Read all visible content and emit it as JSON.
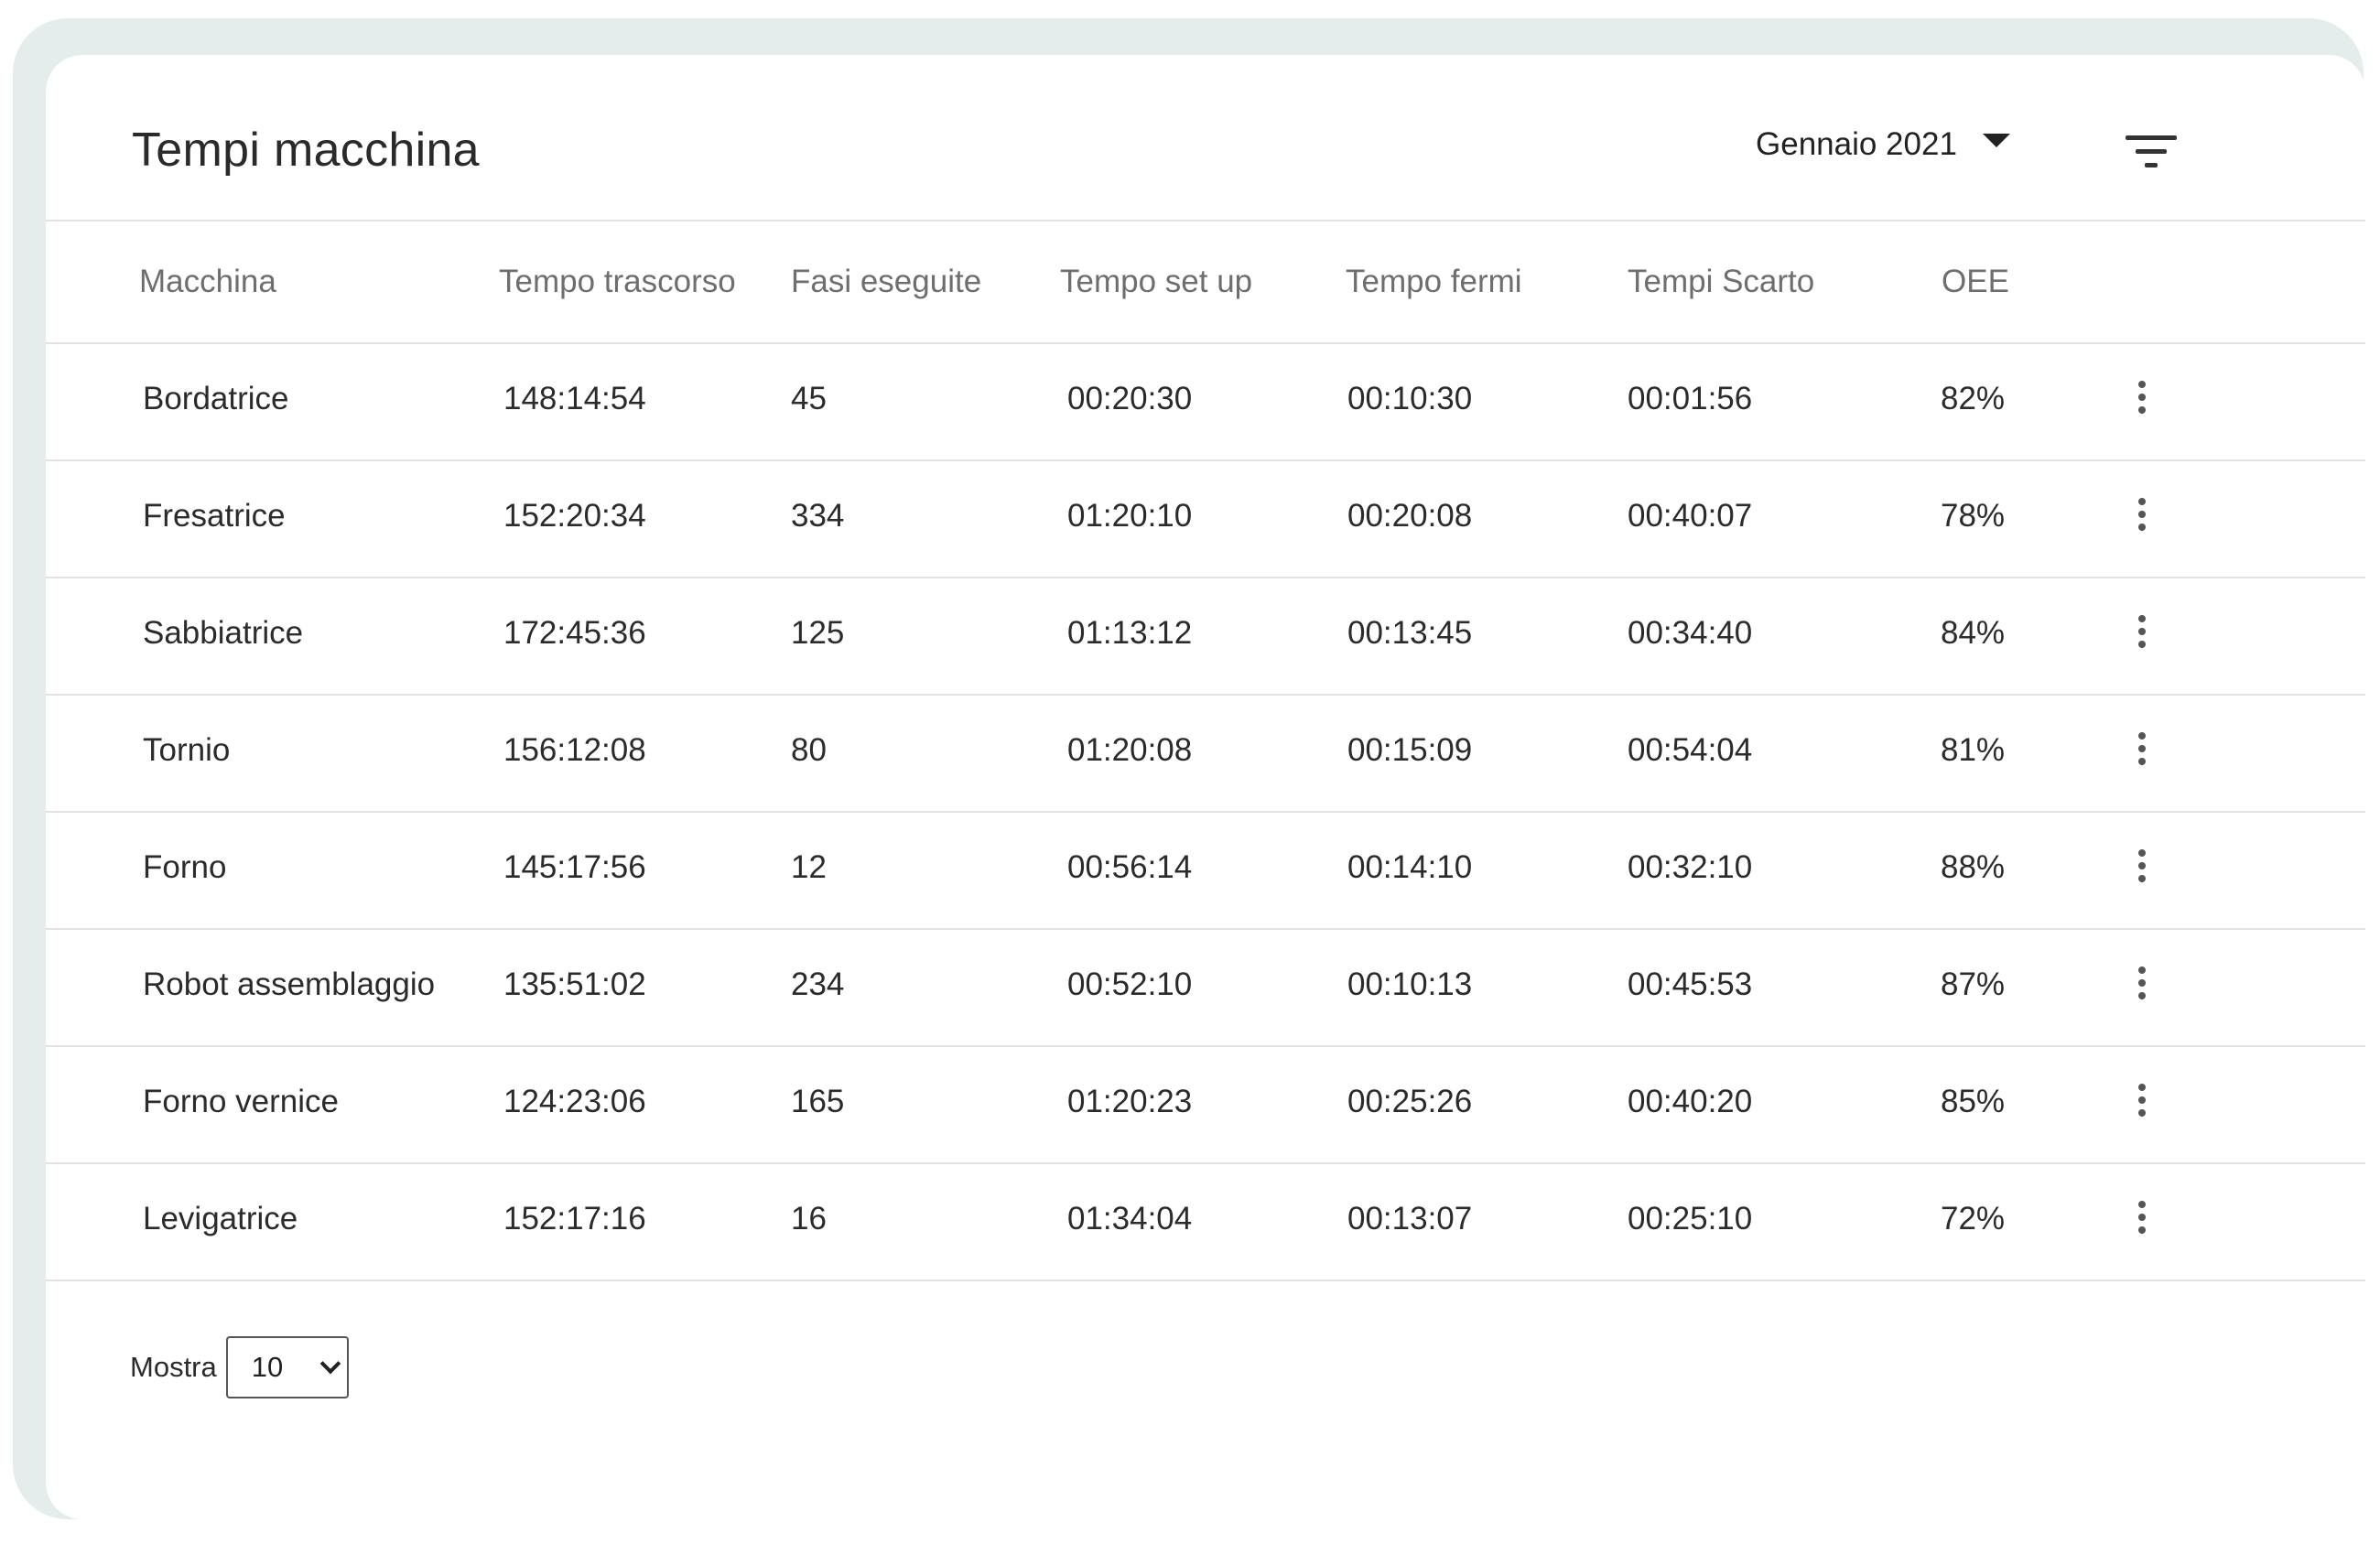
{
  "header": {
    "title": "Tempi macchina",
    "month_selector": {
      "value": "Gennaio 2021",
      "icon": "caret-down-icon"
    },
    "filter": {
      "icon": "filter-icon"
    }
  },
  "table": {
    "columns": [
      "Macchina",
      "Tempo trascorso",
      "Fasi eseguite",
      "Tempo set up",
      "Tempo fermi",
      "Tempi Scarto",
      "OEE"
    ],
    "rows": [
      [
        "Bordatrice",
        "148:14:54",
        "45",
        "00:20:30",
        "00:10:30",
        "00:01:56",
        "82%"
      ],
      [
        "Fresatrice",
        "152:20:34",
        "334",
        "01:20:10",
        "00:20:08",
        "00:40:07",
        "78%"
      ],
      [
        "Sabbiatrice",
        "172:45:36",
        "125",
        "01:13:12",
        "00:13:45",
        "00:34:40",
        "84%"
      ],
      [
        "Tornio",
        "156:12:08",
        "80",
        "01:20:08",
        "00:15:09",
        "00:54:04",
        "81%"
      ],
      [
        "Forno",
        "145:17:56",
        "12",
        "00:56:14",
        "00:14:10",
        "00:32:10",
        "88%"
      ],
      [
        "Robot assemblaggio",
        "135:51:02",
        "234",
        "00:52:10",
        "00:10:13",
        "00:45:53",
        "87%"
      ],
      [
        "Forno vernice",
        "124:23:06",
        "165",
        "01:20:23",
        "00:25:26",
        "00:40:20",
        "85%"
      ],
      [
        "Levigatrice",
        "152:17:16",
        "16",
        "01:34:04",
        "00:13:07",
        "00:25:10",
        "72%"
      ]
    ],
    "row_action_icon": "more-vertical-icon"
  },
  "footer": {
    "show_label": "Mostra",
    "page_size": "10"
  }
}
